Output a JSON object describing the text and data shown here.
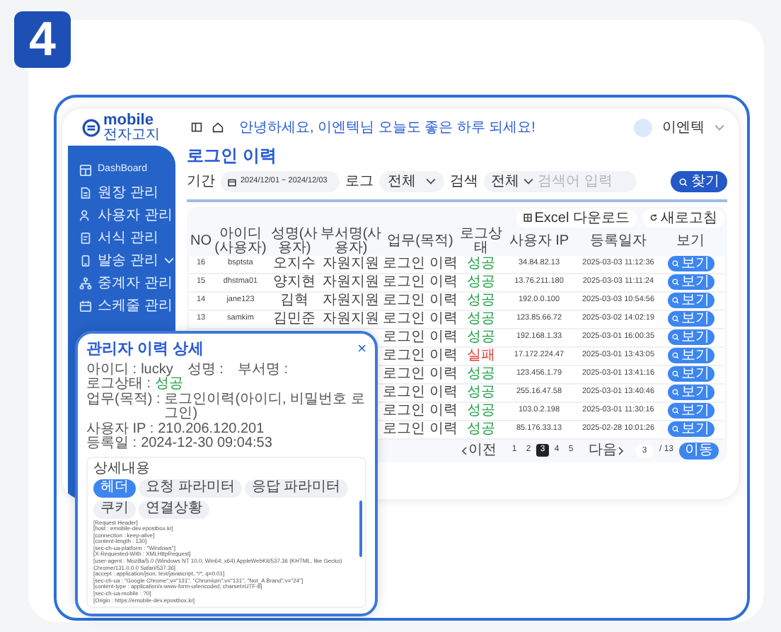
{
  "step_badge": "4",
  "app": {
    "logo": {
      "name": "mobile",
      "sub": "전자고지"
    },
    "greeting": "안녕하세요, 이엔텍님 오늘도 좋은 하루 되세요!",
    "user": "이엔텍",
    "sidebar": {
      "items": [
        {
          "label": "DashBoard",
          "kind": "dashboard",
          "expandable": false
        },
        {
          "label": "원장 관리",
          "kind": "document",
          "expandable": false
        },
        {
          "label": "사용자 관리",
          "kind": "users",
          "expandable": false
        },
        {
          "label": "서식 관리",
          "kind": "form",
          "expandable": false
        },
        {
          "label": "발송 관리",
          "kind": "send",
          "expandable": true
        },
        {
          "label": "중계자 관리",
          "kind": "network",
          "expandable": false
        },
        {
          "label": "스케줄 관리",
          "kind": "calendar",
          "expandable": false
        }
      ]
    },
    "page_title": "로그인 이력",
    "filters": {
      "period_label": "기간",
      "period": "2024/12/01 ~ 2024/12/03",
      "log_label": "로그",
      "log_value": "전체",
      "search_label": "검색",
      "search_value": "전체",
      "search_placeholder": "검색어 입력",
      "find_button": "찾기"
    },
    "toolbar": [
      "Excel 다운로드",
      "새로고침"
    ],
    "table": {
      "columns": [
        "NO",
        "아이디(사용자)",
        "성명(사용자)",
        "부서명(사용자)",
        "업무(목적)",
        "로그상태",
        "사용자 IP",
        "등록일자",
        "보기"
      ],
      "rows": [
        {
          "no": "16",
          "id": "bsptsta",
          "name": "오지수",
          "dept": "자원지원",
          "task": "로그인 이력",
          "status": "성공",
          "kind": "success",
          "ip": "34.84.82.13",
          "date": "2025-03-03 11:12:36",
          "view": "보기"
        },
        {
          "no": "15",
          "id": "dhstma01",
          "name": "양지현",
          "dept": "자원지원",
          "task": "로그인 이력",
          "status": "성공",
          "kind": "success",
          "ip": "13.76.211.180",
          "date": "2025-03-03 11:11:24",
          "view": "보기"
        },
        {
          "no": "14",
          "id": "jane123",
          "name": "김혁",
          "dept": "자원지원",
          "task": "로그인 이력",
          "status": "성공",
          "kind": "success",
          "ip": "192.0.0.100",
          "date": "2025-03-03 10:54:56",
          "view": "보기"
        },
        {
          "no": "13",
          "id": "samkim",
          "name": "김민준",
          "dept": "자원지원",
          "task": "로그인 이력",
          "status": "성공",
          "kind": "success",
          "ip": "123.85.66.72",
          "date": "2025-03-02 14:02:19",
          "view": "보기"
        },
        {
          "task": "로그인 이력",
          "status": "성공",
          "kind": "success",
          "ip": "192.168.1.33",
          "date": "2025-03-01 16:00:35",
          "view": "보기"
        },
        {
          "task": "로그인 이력",
          "status": "실패",
          "kind": "failure",
          "ip": "17.172.224.47",
          "date": "2025-03-01 13:43:05",
          "view": "보기"
        },
        {
          "task": "로그인 이력",
          "status": "성공",
          "kind": "success",
          "ip": "123.456.1.79",
          "date": "2025-03-01 13:41:16",
          "view": "보기"
        },
        {
          "task": "로그인 이력",
          "status": "성공",
          "kind": "success",
          "ip": "255.16.47.58",
          "date": "2025-03-01 13:40:46",
          "view": "보기"
        },
        {
          "task": "로그인 이력",
          "status": "성공",
          "kind": "success",
          "ip": "103.0.2.198",
          "date": "2025-03-01 11:30:16",
          "view": "보기"
        },
        {
          "task": "로그인 이력",
          "status": "성공",
          "kind": "success",
          "ip": "85.176.33.13",
          "date": "2025-02-28 10:01:26",
          "view": "보기"
        }
      ]
    },
    "pagination": {
      "prev": "이전",
      "next": "다음",
      "pages": [
        {
          "label": "1",
          "selected": false
        },
        {
          "label": "2",
          "selected": false
        },
        {
          "label": "3",
          "selected": true
        },
        {
          "label": "4",
          "selected": false
        },
        {
          "label": "5",
          "selected": false
        }
      ],
      "page_input": "3",
      "total": "/ 13",
      "go": "이동"
    }
  },
  "dialog": {
    "title": "관리자 이력 상세",
    "close": "×",
    "fields": [
      {
        "label": "아이디 :",
        "value": "lucky",
        "kind": "plain"
      },
      {
        "label": "성명 :"
      },
      {
        "label": "부서명 :"
      },
      {
        "label": "로그상태 :",
        "value": "성공",
        "kind": "success"
      },
      {
        "label": "업무(목적) :",
        "value": "로그인이력(아이디, 비밀번호 로그인)",
        "kind": "plain"
      },
      {
        "label": "사용자 IP :",
        "value": "210.206.120.201",
        "kind": "plain"
      },
      {
        "label": "등록일 :",
        "value": "2024-12-30 09:04:53",
        "kind": "plain"
      }
    ],
    "section_title": "상세내용",
    "tabs": [
      {
        "label": "헤더",
        "selected": true
      },
      {
        "label": "요청 파라미터",
        "selected": false
      },
      {
        "label": "응답 파라미터",
        "selected": false
      },
      {
        "label": "쿠키",
        "selected": false
      },
      {
        "label": "연결상황",
        "selected": false
      }
    ],
    "lines": [
      "[Request Header]",
      "[host : emobile-dev.epostbox.kr]",
      "[connection : keep-alive]",
      "[content-length : 130]",
      "[sec-ch-ua-platform : \"Windows\"]",
      "[X-Requested-With : XMLHttpRequest]",
      "[user-agent : Mozilla/5.0 (Windows NT 10.0; Win64; x64) AppleWebKit/537.36 (KHTML, like Gecko) Chrome/131.0.0.0 Safari/537.36]",
      "[accept : application/json, text/javascript, */*; q=0.01]",
      "[sec-ch-ua : \"Google Chrome\";v=\"131\", \"Chromium\";v=\"131\", \"Not_A Brand\";v=\"24\"]",
      "[content-type : application/x-www-form-urlencoded; charset=UTF-8]",
      "[sec-ch-ua-mobile : ?0]",
      "[Origin : https://emobile-dev.epostbox.kr]"
    ]
  }
}
